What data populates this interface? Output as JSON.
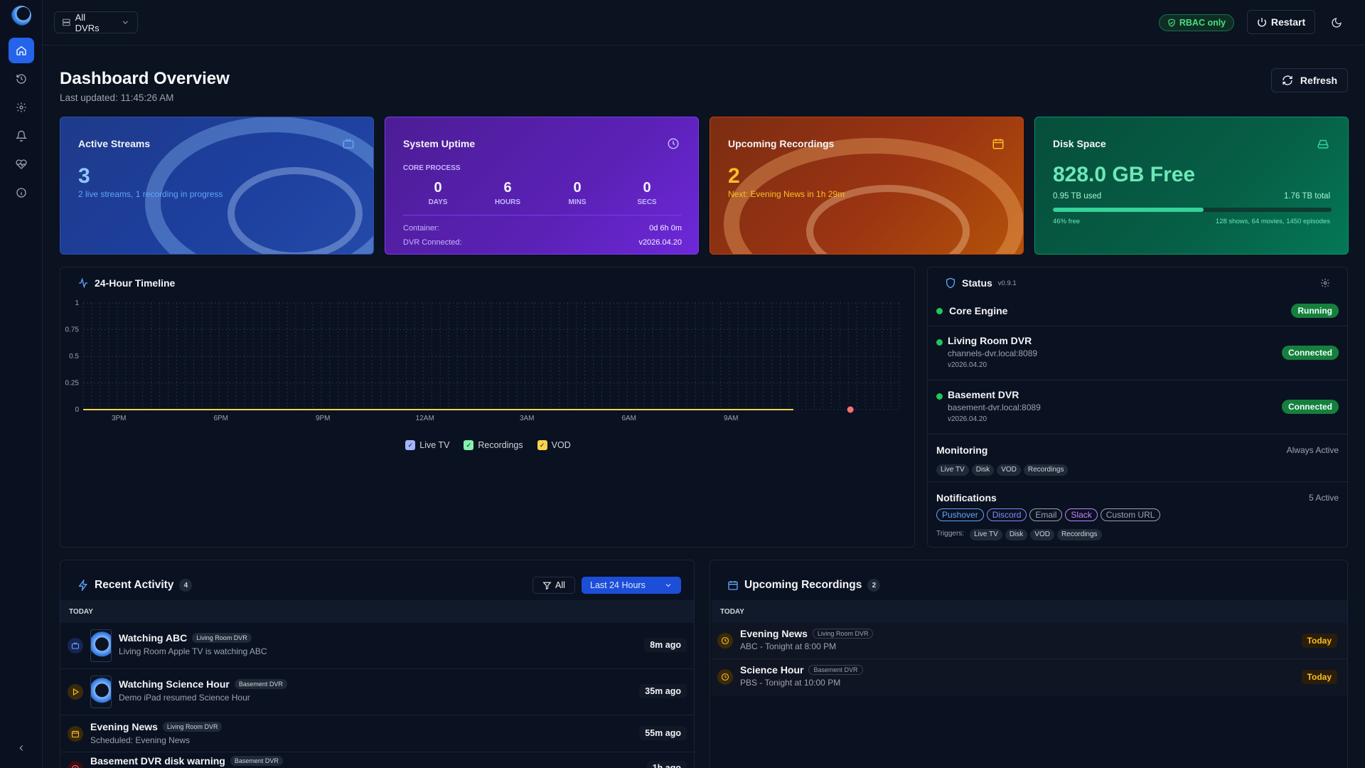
{
  "topbar": {
    "dvr_select": "All DVRs",
    "rbac_label": "RBAC only",
    "restart_label": "Restart"
  },
  "header": {
    "title": "Dashboard Overview",
    "last_updated": "Last updated: 11:45:26 AM",
    "refresh_label": "Refresh"
  },
  "cards": {
    "active_streams": {
      "title": "Active Streams",
      "value": "3",
      "sub": "2 live streams, 1 recording in progress"
    },
    "uptime": {
      "title": "System Uptime",
      "core_label": "CORE PROCESS",
      "cells": [
        {
          "value": "0",
          "unit": "DAYS"
        },
        {
          "value": "6",
          "unit": "HOURS"
        },
        {
          "value": "0",
          "unit": "MINS"
        },
        {
          "value": "0",
          "unit": "SECS"
        }
      ],
      "container_label": "Container:",
      "container_value": "0d 6h 0m",
      "dvr_label": "DVR Connected:",
      "dvr_value": "v2026.04.20"
    },
    "upcoming": {
      "title": "Upcoming Recordings",
      "value": "2",
      "sub": "Next: Evening News in 1h 29m"
    },
    "disk": {
      "title": "Disk Space",
      "free": "828.0 GB Free",
      "used": "0.95 TB used",
      "total": "1.76 TB total",
      "free_percent_label": "46% free",
      "used_fraction": 0.54,
      "counts": "128 shows, 64 movies, 1450 episodes"
    }
  },
  "timeline": {
    "title": "24-Hour Timeline"
  },
  "chart_data": {
    "type": "line",
    "title": "24-Hour Timeline",
    "x_ticks": [
      "3PM",
      "6PM",
      "9PM",
      "12AM",
      "3AM",
      "6AM",
      "9AM"
    ],
    "y_ticks": [
      "0",
      "0.25",
      "0.5",
      "0.75",
      "1"
    ],
    "ylim": [
      0,
      1
    ],
    "series": [
      {
        "name": "Live TV",
        "color": "#a5b4fc",
        "values": [
          0,
          0,
          0,
          0,
          0,
          0,
          0
        ]
      },
      {
        "name": "Recordings",
        "color": "#86efac",
        "values": [
          0,
          0,
          0,
          0,
          0,
          0,
          0
        ]
      },
      {
        "name": "VOD",
        "color": "#fcd34d",
        "values": [
          0,
          0,
          0,
          0,
          0,
          0,
          0
        ]
      }
    ],
    "grid": true,
    "legend_position": "bottom"
  },
  "status": {
    "title": "Status",
    "version": "v0.9.1",
    "core": {
      "name": "Core Engine",
      "state": "Running"
    },
    "dvrs": [
      {
        "name": "Living Room DVR",
        "host": "channels-dvr.local:8089",
        "version": "v2026.04.20",
        "state": "Connected"
      },
      {
        "name": "Basement DVR",
        "host": "basement-dvr.local:8089",
        "version": "v2026.04.20",
        "state": "Connected"
      }
    ],
    "monitoring": {
      "title": "Monitoring",
      "state": "Always Active",
      "tags": [
        "Live TV",
        "Disk",
        "VOD",
        "Recordings"
      ]
    },
    "notifications": {
      "title": "Notifications",
      "state": "5 Active",
      "channels": [
        {
          "label": "Pushover",
          "color": "#60a5fa"
        },
        {
          "label": "Discord",
          "color": "#818cf8"
        },
        {
          "label": "Email",
          "color": "#9ca3af"
        },
        {
          "label": "Slack",
          "color": "#c084fc"
        },
        {
          "label": "Custom URL",
          "color": "#9ca3af"
        }
      ],
      "triggers_label": "Triggers:",
      "triggers": [
        "Live TV",
        "Disk",
        "VOD",
        "Recordings"
      ]
    }
  },
  "activity": {
    "title": "Recent Activity",
    "count": "4",
    "filter_label": "All",
    "range_label": "Last 24 Hours",
    "day_label": "TODAY",
    "items": [
      {
        "title": "Watching ABC",
        "badge": "Living Room DVR",
        "sub": "Living Room Apple TV is watching ABC",
        "time": "8m ago"
      },
      {
        "title": "Watching Science Hour",
        "badge": "Basement DVR",
        "sub": "Demo iPad resumed Science Hour",
        "time": "35m ago"
      },
      {
        "title": "Evening News",
        "badge": "Living Room DVR",
        "sub": "Scheduled: Evening News",
        "time": "55m ago"
      },
      {
        "title": "Basement DVR disk warning",
        "badge": "Basement DVR",
        "sub": "",
        "time": "1h ago"
      }
    ]
  },
  "upcoming_list": {
    "title": "Upcoming Recordings",
    "count": "2",
    "day_label": "TODAY",
    "items": [
      {
        "title": "Evening News",
        "badge": "Living Room DVR",
        "sub": "ABC - Tonight at 8:00 PM",
        "when": "Today"
      },
      {
        "title": "Science Hour",
        "badge": "Basement DVR",
        "sub": "PBS - Tonight at 10:00 PM",
        "when": "Today"
      }
    ]
  }
}
